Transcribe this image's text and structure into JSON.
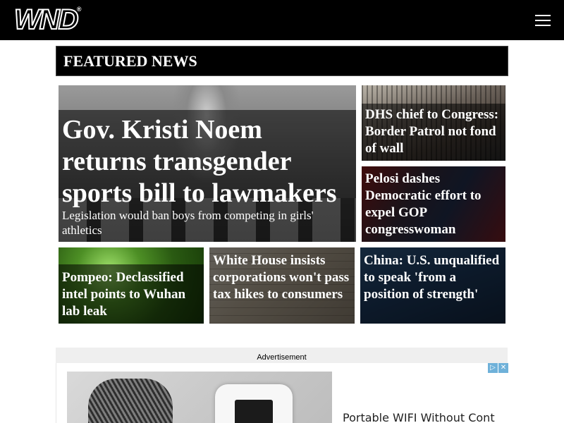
{
  "header": {
    "logo_text": "WND",
    "logo_mark": "®",
    "menu_icon": "hamburger-menu-icon",
    "bg_color": "#000000"
  },
  "featured": {
    "heading": "FEATURED NEWS",
    "stories": [
      {
        "title": "Gov. Kristi Noem returns transgender sports bill to lawmakers",
        "subtitle": "Legislation would ban boys from competing in girls' athletics"
      },
      {
        "title": "DHS chief to Congress: Border Patrol not fond of wall"
      },
      {
        "title": "Pelosi dashes Democratic effort to expel GOP congresswoman"
      },
      {
        "title": "Pompeo: Declassified intel points to Wuhan lab leak"
      },
      {
        "title": "White House insists corporations won't pass tax hikes to consumers"
      },
      {
        "title": "China: U.S. unqualified to speak 'from a position of strength'"
      }
    ]
  },
  "advertisement": {
    "label": "Advertisement",
    "headline": "Portable WIFI Without Cont",
    "info_icon": "ad-info-icon",
    "close_icon": "ad-close-icon",
    "info_glyph": "▷",
    "close_glyph": "✕"
  }
}
